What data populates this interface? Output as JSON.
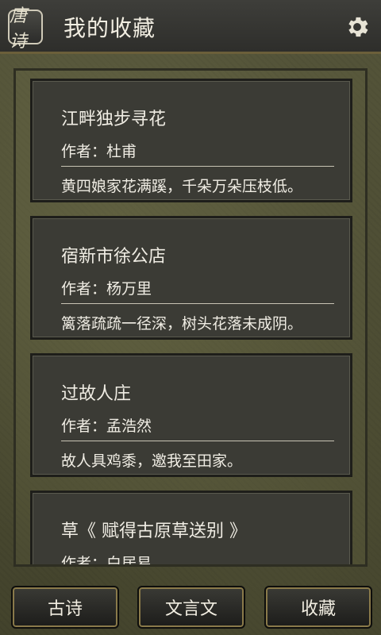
{
  "header": {
    "logo_text": "唐诗",
    "title": "我的收藏"
  },
  "poems": [
    {
      "title": "江畔独步寻花",
      "author": "作者：杜甫",
      "line": "黄四娘家花满蹊，千朵万朵压枝低。"
    },
    {
      "title": "宿新市徐公店",
      "author": "作者：杨万里",
      "line": "篱落疏疏一径深，树头花落未成阴。"
    },
    {
      "title": "过故人庄",
      "author": "作者：孟浩然",
      "line": "故人具鸡黍，邀我至田家。"
    },
    {
      "title": "草《 赋得古原草送别 》",
      "author": "作者：白居易",
      "line": ""
    }
  ],
  "nav": [
    {
      "label": "古诗"
    },
    {
      "label": "文言文"
    },
    {
      "label": "收藏"
    }
  ],
  "colors": {
    "header_bg": "#2e2e2b",
    "card_bg": "#3b3b35",
    "accent": "#8a7a4a",
    "text": "#f0ede4"
  }
}
